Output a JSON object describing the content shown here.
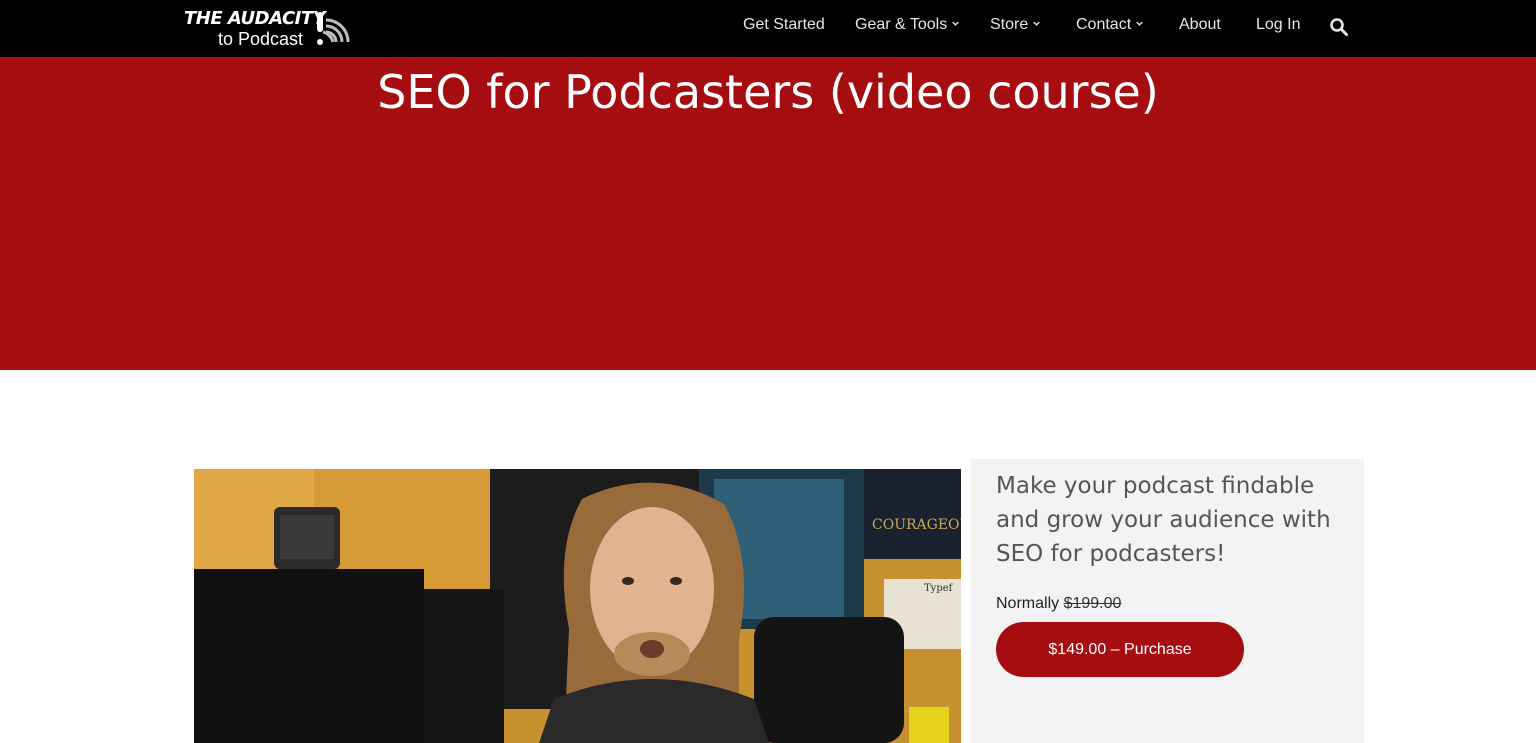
{
  "brand": {
    "logo_line1": "THE AUDACITY",
    "logo_line2": "to Podcast"
  },
  "nav": {
    "items": [
      {
        "label": "Get Started",
        "has_dropdown": false
      },
      {
        "label": "Gear & Tools",
        "has_dropdown": true
      },
      {
        "label": "Store",
        "has_dropdown": true
      },
      {
        "label": "Contact",
        "has_dropdown": true
      },
      {
        "label": "About",
        "has_dropdown": false
      },
      {
        "label": "Log In",
        "has_dropdown": false
      }
    ],
    "search_icon": "search-icon"
  },
  "hero": {
    "title": "SEO for Podcasters (video course)"
  },
  "product": {
    "heading": "Make your podcast findable and grow your audience with SEO for podcasters!",
    "normally_label": "Normally",
    "old_price": "$199.00",
    "buy_label": "$149.00 – Purchase"
  },
  "colors": {
    "brand_red": "#a50d11",
    "nav_bg": "#000000",
    "sidebar_bg": "#f3f3f3"
  }
}
